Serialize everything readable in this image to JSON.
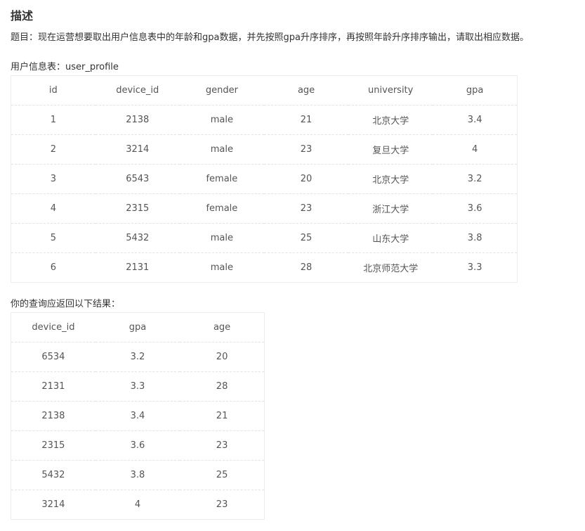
{
  "heading": "描述",
  "prompt": "题目：现在运营想要取出用户信息表中的年龄和gpa数据，并先按照gpa升序排序，再按照年龄升序排序输出，请取出相应数据。",
  "table1": {
    "caption": "用户信息表：user_profile",
    "headers": [
      "id",
      "device_id",
      "gender",
      "age",
      "university",
      "gpa"
    ],
    "rows": [
      [
        "1",
        "2138",
        "male",
        "21",
        "北京大学",
        "3.4"
      ],
      [
        "2",
        "3214",
        "male",
        "23",
        "复旦大学",
        "4"
      ],
      [
        "3",
        "6543",
        "female",
        "20",
        "北京大学",
        "3.2"
      ],
      [
        "4",
        "2315",
        "female",
        "23",
        "浙江大学",
        "3.6"
      ],
      [
        "5",
        "5432",
        "male",
        "25",
        "山东大学",
        "3.8"
      ],
      [
        "6",
        "2131",
        "male",
        "28",
        "北京师范大学",
        "3.3"
      ]
    ]
  },
  "table2": {
    "caption": "你的查询应返回以下结果：",
    "headers": [
      "device_id",
      "gpa",
      "age"
    ],
    "rows": [
      [
        "6534",
        "3.2",
        "20"
      ],
      [
        "2131",
        "3.3",
        "28"
      ],
      [
        "2138",
        "3.4",
        "21"
      ],
      [
        "2315",
        "3.6",
        "23"
      ],
      [
        "5432",
        "3.8",
        "25"
      ],
      [
        "3214",
        "4",
        "23"
      ]
    ]
  }
}
